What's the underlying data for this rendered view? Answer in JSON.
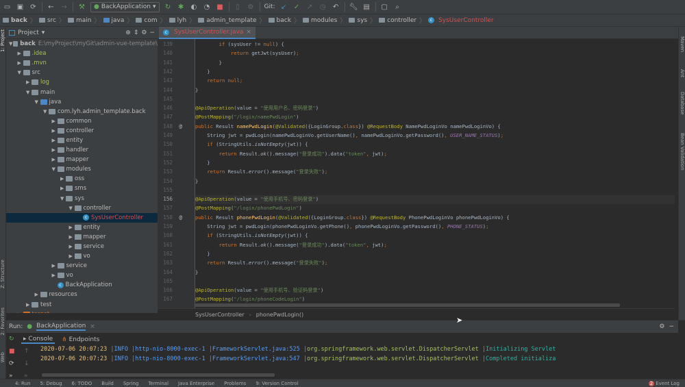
{
  "toolbar": {
    "run_config": "BackApplication",
    "git_label": "Git:"
  },
  "breadcrumbs": [
    "back",
    "src",
    "main",
    "java",
    "com",
    "lyh",
    "admin_template",
    "back",
    "modules",
    "sys",
    "controller",
    "SysUserController"
  ],
  "left_strip": {
    "project": "1: Project",
    "structure": "Z: Structure",
    "favorites": "2: Favorites",
    "web": "Web"
  },
  "right_strip": {
    "maven": "Maven",
    "ant": "Ant",
    "database": "Database",
    "bean_validation": "Bean Validation"
  },
  "project_panel": {
    "title": "Project",
    "root_path": "E:\\myProject\\myGit\\admin-vue-template\\"
  },
  "tree": [
    {
      "level": 0,
      "name": "back",
      "open": true,
      "kind": "module"
    },
    {
      "level": 1,
      "name": ".idea",
      "open": false,
      "kind": "folder",
      "color": "#a5c25c"
    },
    {
      "level": 1,
      "name": ".mvn",
      "open": false,
      "kind": "folder",
      "color": "#a5c25c"
    },
    {
      "level": 1,
      "name": "src",
      "open": true,
      "kind": "folder"
    },
    {
      "level": 2,
      "name": "log",
      "open": false,
      "kind": "folder",
      "color": "#a5c25c"
    },
    {
      "level": 2,
      "name": "main",
      "open": true,
      "kind": "folder"
    },
    {
      "level": 3,
      "name": "java",
      "open": true,
      "kind": "src"
    },
    {
      "level": 4,
      "name": "com.lyh.admin_template.back",
      "open": true,
      "kind": "pkg"
    },
    {
      "level": 5,
      "name": "common",
      "open": false,
      "kind": "pkg"
    },
    {
      "level": 5,
      "name": "controller",
      "open": false,
      "kind": "pkg"
    },
    {
      "level": 5,
      "name": "entity",
      "open": false,
      "kind": "pkg"
    },
    {
      "level": 5,
      "name": "handler",
      "open": false,
      "kind": "pkg"
    },
    {
      "level": 5,
      "name": "mapper",
      "open": false,
      "kind": "pkg"
    },
    {
      "level": 5,
      "name": "modules",
      "open": true,
      "kind": "pkg"
    },
    {
      "level": 6,
      "name": "oss",
      "open": false,
      "kind": "pkg"
    },
    {
      "level": 6,
      "name": "sms",
      "open": false,
      "kind": "pkg"
    },
    {
      "level": 6,
      "name": "sys",
      "open": true,
      "kind": "pkg"
    },
    {
      "level": 7,
      "name": "controller",
      "open": true,
      "kind": "pkg"
    },
    {
      "level": 8,
      "name": "SysUserController",
      "kind": "class",
      "selected": true,
      "color": "#d25252"
    },
    {
      "level": 7,
      "name": "entity",
      "open": false,
      "kind": "pkg"
    },
    {
      "level": 7,
      "name": "mapper",
      "open": false,
      "kind": "pkg"
    },
    {
      "level": 7,
      "name": "service",
      "open": false,
      "kind": "pkg"
    },
    {
      "level": 7,
      "name": "vo",
      "open": false,
      "kind": "pkg"
    },
    {
      "level": 5,
      "name": "service",
      "open": false,
      "kind": "pkg"
    },
    {
      "level": 5,
      "name": "vo",
      "open": false,
      "kind": "pkg"
    },
    {
      "level": 5,
      "name": "BackApplication",
      "kind": "class"
    },
    {
      "level": 3,
      "name": "resources",
      "open": false,
      "kind": "folder"
    },
    {
      "level": 2,
      "name": "test",
      "open": false,
      "kind": "folder"
    },
    {
      "level": 1,
      "name": "target",
      "open": false,
      "kind": "folder",
      "color": "#d0702a"
    }
  ],
  "editor": {
    "tab": "SysUserController.java",
    "current_line": 156,
    "lines": [
      {
        "n": 139,
        "t": [
          [
            "",
            "        "
          ],
          [
            "kw",
            "if"
          ],
          [
            "",
            " (sysUser != "
          ],
          [
            "kw",
            "null"
          ],
          [
            "",
            ") {"
          ]
        ]
      },
      {
        "n": 140,
        "t": [
          [
            "",
            "            "
          ],
          [
            "kw",
            "return"
          ],
          [
            "",
            " getJwt(sysUser)"
          ],
          [
            "kw",
            ";"
          ]
        ]
      },
      {
        "n": 141,
        "t": [
          [
            "",
            "        }"
          ]
        ]
      },
      {
        "n": 142,
        "t": [
          [
            "",
            "    }"
          ]
        ]
      },
      {
        "n": 143,
        "t": [
          [
            "",
            "    "
          ],
          [
            "kw",
            "return null;"
          ]
        ]
      },
      {
        "n": 144,
        "t": [
          [
            "",
            "}"
          ]
        ]
      },
      {
        "n": 145,
        "t": []
      },
      {
        "n": 146,
        "t": [
          [
            "ann",
            "@ApiOperation"
          ],
          [
            "",
            "(value = "
          ],
          [
            "str",
            "\"使用用户名、密码登录\""
          ],
          [
            "",
            ")"
          ]
        ]
      },
      {
        "n": 147,
        "t": [
          [
            "ann",
            "@PostMapping"
          ],
          [
            "",
            "("
          ],
          [
            "str",
            "\"/login/namePwdLogin\""
          ],
          [
            "",
            ")"
          ]
        ]
      },
      {
        "n": 148,
        "t": [
          [
            "kw",
            "public "
          ],
          [
            "",
            "Result "
          ],
          [
            "fn",
            "namePwdLogin"
          ],
          [
            "",
            "("
          ],
          [
            "ann",
            "@Validated"
          ],
          [
            "",
            "({LoginGroup."
          ],
          [
            "kw",
            "class"
          ],
          [
            "",
            "}) "
          ],
          [
            "ann",
            "@RequestBody"
          ],
          [
            "",
            " NamePwdLoginVo namePwdLoginVo) {"
          ]
        ]
      },
      {
        "n": 149,
        "t": [
          [
            "",
            "    String jwt = pwdLogin(namePwdLoginVo.getUserName()"
          ],
          [
            "kw",
            ", "
          ],
          [
            "",
            "namePwdLoginVo.getPassword()"
          ],
          [
            "kw",
            ", "
          ],
          [
            "cst",
            "USER_NAME_STATUS"
          ],
          [
            "",
            ")"
          ],
          [
            "kw",
            ";"
          ]
        ]
      },
      {
        "n": 150,
        "t": [
          [
            "",
            "    "
          ],
          [
            "kw",
            "if"
          ],
          [
            "",
            " (StringUtils."
          ],
          [
            "it",
            "isNotEmpty"
          ],
          [
            "",
            "(jwt)) {"
          ]
        ]
      },
      {
        "n": 151,
        "t": [
          [
            "",
            "        "
          ],
          [
            "kw",
            "return"
          ],
          [
            "",
            " Result."
          ],
          [
            "it",
            "ok"
          ],
          [
            "",
            "().message("
          ],
          [
            "str",
            "\"登录成功\""
          ],
          [
            "",
            ").data("
          ],
          [
            "str",
            "\"token\""
          ],
          [
            "kw",
            ", "
          ],
          [
            "",
            "jwt)"
          ],
          [
            "kw",
            ";"
          ]
        ]
      },
      {
        "n": 152,
        "t": [
          [
            "",
            "    }"
          ]
        ]
      },
      {
        "n": 153,
        "t": [
          [
            "",
            "    "
          ],
          [
            "kw",
            "return"
          ],
          [
            "",
            " Result."
          ],
          [
            "it",
            "error"
          ],
          [
            "",
            "().message("
          ],
          [
            "str",
            "\"登录失败\""
          ],
          [
            "",
            ")"
          ],
          [
            "kw",
            ";"
          ]
        ]
      },
      {
        "n": 154,
        "t": [
          [
            "",
            "}"
          ]
        ]
      },
      {
        "n": 155,
        "t": []
      },
      {
        "n": 156,
        "t": [
          [
            "ann",
            "@ApiOperation"
          ],
          [
            "",
            "(value = "
          ],
          [
            "str",
            "\"使用手机号、密码登录\""
          ],
          [
            "",
            ")"
          ]
        ]
      },
      {
        "n": 157,
        "t": [
          [
            "ann",
            "@PostMapping"
          ],
          [
            "",
            "("
          ],
          [
            "str",
            "\"/login/phonePwdLogin\""
          ],
          [
            "",
            ")"
          ]
        ]
      },
      {
        "n": 158,
        "t": [
          [
            "kw",
            "public "
          ],
          [
            "",
            "Result "
          ],
          [
            "fn",
            "phonePwdLogin"
          ],
          [
            "",
            "("
          ],
          [
            "ann",
            "@Validated"
          ],
          [
            "",
            "({LoginGroup."
          ],
          [
            "kw",
            "class"
          ],
          [
            "",
            "}) "
          ],
          [
            "ann",
            "@RequestBody"
          ],
          [
            "",
            " PhonePwdLoginVo phonePwdLoginVo) {"
          ]
        ]
      },
      {
        "n": 159,
        "t": [
          [
            "",
            "    String jwt = pwdLogin(phonePwdLoginVo.getPhone()"
          ],
          [
            "kw",
            ", "
          ],
          [
            "",
            "phonePwdLoginVo.getPassword()"
          ],
          [
            "kw",
            ", "
          ],
          [
            "cst",
            "PHONE_STATUS"
          ],
          [
            "",
            ")"
          ],
          [
            "kw",
            ";"
          ]
        ]
      },
      {
        "n": 160,
        "t": [
          [
            "",
            "    "
          ],
          [
            "kw",
            "if"
          ],
          [
            "",
            " (StringUtils."
          ],
          [
            "it",
            "isNotEmpty"
          ],
          [
            "",
            "(jwt)) {"
          ]
        ]
      },
      {
        "n": 161,
        "t": [
          [
            "",
            "        "
          ],
          [
            "kw",
            "return"
          ],
          [
            "",
            " Result."
          ],
          [
            "it",
            "ok"
          ],
          [
            "",
            "().message("
          ],
          [
            "str",
            "\"登录成功\""
          ],
          [
            "",
            ").data("
          ],
          [
            "str",
            "\"token\""
          ],
          [
            "kw",
            ", "
          ],
          [
            "",
            "jwt)"
          ],
          [
            "kw",
            ";"
          ]
        ]
      },
      {
        "n": 162,
        "t": [
          [
            "",
            "    }"
          ]
        ]
      },
      {
        "n": 163,
        "t": [
          [
            "",
            "    "
          ],
          [
            "kw",
            "return"
          ],
          [
            "",
            " Result."
          ],
          [
            "it",
            "error"
          ],
          [
            "",
            "().message("
          ],
          [
            "str",
            "\"登录失败\""
          ],
          [
            "",
            ")"
          ],
          [
            "kw",
            ";"
          ]
        ]
      },
      {
        "n": 164,
        "t": [
          [
            "",
            "}"
          ]
        ]
      },
      {
        "n": 165,
        "t": []
      },
      {
        "n": 166,
        "t": [
          [
            "ann",
            "@ApiOperation"
          ],
          [
            "",
            "(value = "
          ],
          [
            "str",
            "\"使用手机号、验证码登录\""
          ],
          [
            "",
            ")"
          ]
        ]
      },
      {
        "n": 167,
        "t": [
          [
            "ann",
            "@PostMapping"
          ],
          [
            "",
            "("
          ],
          [
            "str",
            "\"/login/phoneCodeLogin\""
          ],
          [
            "",
            ")"
          ]
        ]
      }
    ],
    "gutter_marks": {
      "148": "@",
      "158": "@"
    },
    "breadcrumb": [
      "SysUserController",
      "phonePwdLogin()"
    ]
  },
  "run": {
    "label": "Run:",
    "config": "BackApplication",
    "tabs": [
      "Console",
      "Endpoints"
    ],
    "log": [
      {
        "time": "2020-07-06 20:07:23",
        "level": "INFO",
        "thread": "http-nio-8000-exec-1",
        "source": "FrameworkServlet.java:525",
        "logger": "org.springframework.web.servlet.DispatcherServlet",
        "msg": "Initializing Servlet"
      },
      {
        "time": "2020-07-06 20:07:23",
        "level": "INFO",
        "thread": "http-nio-8000-exec-1",
        "source": "FrameworkServlet.java:547",
        "logger": "org.springframework.web.servlet.DispatcherServlet",
        "msg": "Completed initializa"
      }
    ]
  },
  "statusbar": {
    "items": [
      "4: Run",
      "5: Debug",
      "6: TODO",
      "Build",
      "Spring",
      "Terminal",
      "Java Enterprise",
      "Problems",
      "9: Version Control"
    ],
    "event_log": "Event Log",
    "event_count": "2"
  }
}
